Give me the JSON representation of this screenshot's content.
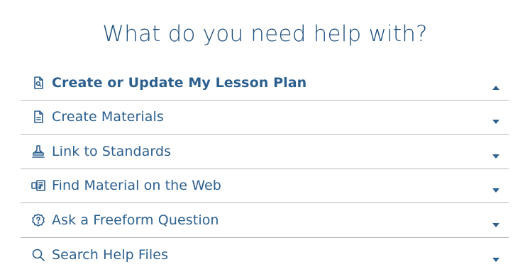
{
  "heading": "What do you need help with?",
  "items": [
    {
      "label": "Create or Update My Lesson Plan",
      "icon": "document-search-icon",
      "state": "expanded"
    },
    {
      "label": "Create Materials",
      "icon": "document-lines-icon",
      "state": "collapsed"
    },
    {
      "label": "Link to Standards",
      "icon": "stamp-icon",
      "state": "collapsed"
    },
    {
      "label": "Find Material on the Web",
      "icon": "web-media-icon",
      "state": "collapsed"
    },
    {
      "label": "Ask a Freeform Question",
      "icon": "question-badge-icon",
      "state": "collapsed"
    },
    {
      "label": "Search Help Files",
      "icon": "search-icon",
      "state": "collapsed"
    }
  ],
  "colors": {
    "accent": "#2b5f8e",
    "heading": "#1e4f7c",
    "divider": "#b9b9b9",
    "background": "#ffffff"
  }
}
